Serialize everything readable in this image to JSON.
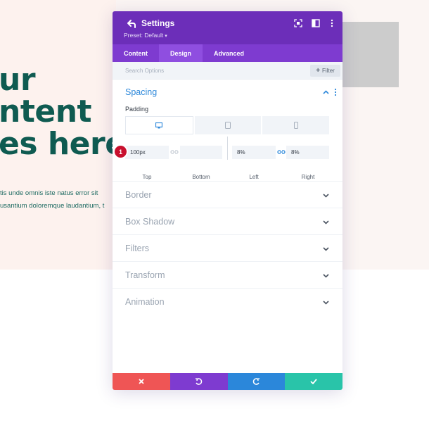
{
  "background": {
    "headline_lines": [
      "ur",
      "ntent",
      "es here."
    ],
    "body_lines": [
      "tis unde omnis iste natus error sit",
      "usantium doloremque laudantium, t"
    ]
  },
  "modal": {
    "title": "Settings",
    "preset": "Preset: Default",
    "header_icons": [
      "back-arrow-icon",
      "expand-icon",
      "split-view-icon",
      "more-vertical-icon"
    ],
    "tabs": [
      {
        "label": "Content",
        "active": false
      },
      {
        "label": "Design",
        "active": true
      },
      {
        "label": "Advanced",
        "active": false
      }
    ],
    "search": {
      "placeholder": "Search Options",
      "filter_label": "Filter"
    },
    "spacing": {
      "title": "Spacing",
      "padding_label": "Padding",
      "devices": [
        "desktop-icon",
        "tablet-icon",
        "phone-icon"
      ],
      "fields": {
        "top": {
          "value": "100px",
          "label": "Top"
        },
        "bottom": {
          "value": "",
          "label": "Bottom"
        },
        "left": {
          "value": "8%",
          "label": "Left"
        },
        "right": {
          "value": "8%",
          "label": "Right"
        }
      },
      "step_badge": "1"
    },
    "sections": [
      "Border",
      "Box Shadow",
      "Filters",
      "Transform",
      "Animation"
    ],
    "actions": [
      "cancel-icon",
      "undo-icon",
      "redo-icon",
      "save-check-icon"
    ]
  },
  "colors": {
    "header_purple": "#6c2eb9",
    "tab_purple": "#7e3bd0",
    "accent_blue": "#2b87da",
    "cancel_red": "#ef5555",
    "save_green": "#29c4a9",
    "headline_green": "#0f5b51",
    "badge_red": "#c8102e"
  }
}
